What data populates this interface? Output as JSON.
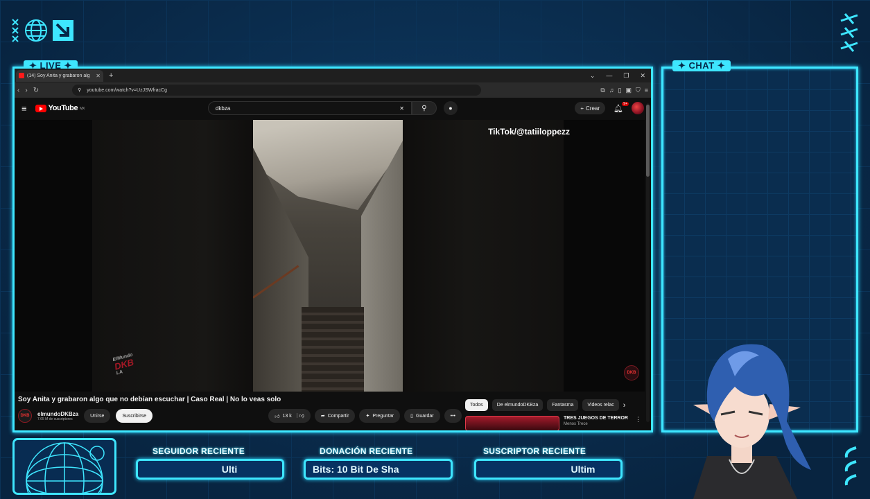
{
  "overlay": {
    "live_label": "✦ LIVE ✦",
    "chat_label": "✦ CHAT ✦",
    "alerts": [
      {
        "title": "SEGUIDOR RECIENTE",
        "value": "Ulti"
      },
      {
        "title": "DONACIÓN RECIENTE",
        "value": "Bits: 10 Bit De Sha"
      },
      {
        "title": "SUSCRIPTOR RECIENTE",
        "value": "Ultim"
      }
    ],
    "colors": {
      "neon": "#3ee6ff",
      "background": "#0a2a4a",
      "alert_fill": "#073262"
    }
  },
  "browser": {
    "tab_title": "(14) Soy Anita y grabaron alg",
    "url": "youtube.com/watch?v=UzJSWfracCg"
  },
  "youtube": {
    "logo_text": "YouTube",
    "country": "MX",
    "search_value": "dkbza",
    "create_label": "Crear",
    "notif_badge": "9+",
    "video_watermark": "TikTok/@tatiiloppezz",
    "video_logo_line1": "ElMundo",
    "video_logo_line2": "DKB",
    "video_logo_line3": "LA",
    "channel_bug": "DKB",
    "video_title": "Soy Anita y grabaron algo que no debían escuchar | Caso Real | No lo veas solo",
    "channel_name": "elmundoDKBza",
    "subscribers": "7.65 M de suscriptores",
    "join_label": "Unirse",
    "subscribe_label": "Suscribirse",
    "likes": "13 k",
    "share_label": "Compartir",
    "ask_label": "Preguntar",
    "save_label": "Guardar",
    "chips": [
      "Todos",
      "De elmundoDKBza",
      "Fantasma",
      "Videos relac"
    ],
    "recommended": {
      "title": "TRES JUEGOS DE TERROR",
      "channel": "Menos Trece"
    }
  }
}
